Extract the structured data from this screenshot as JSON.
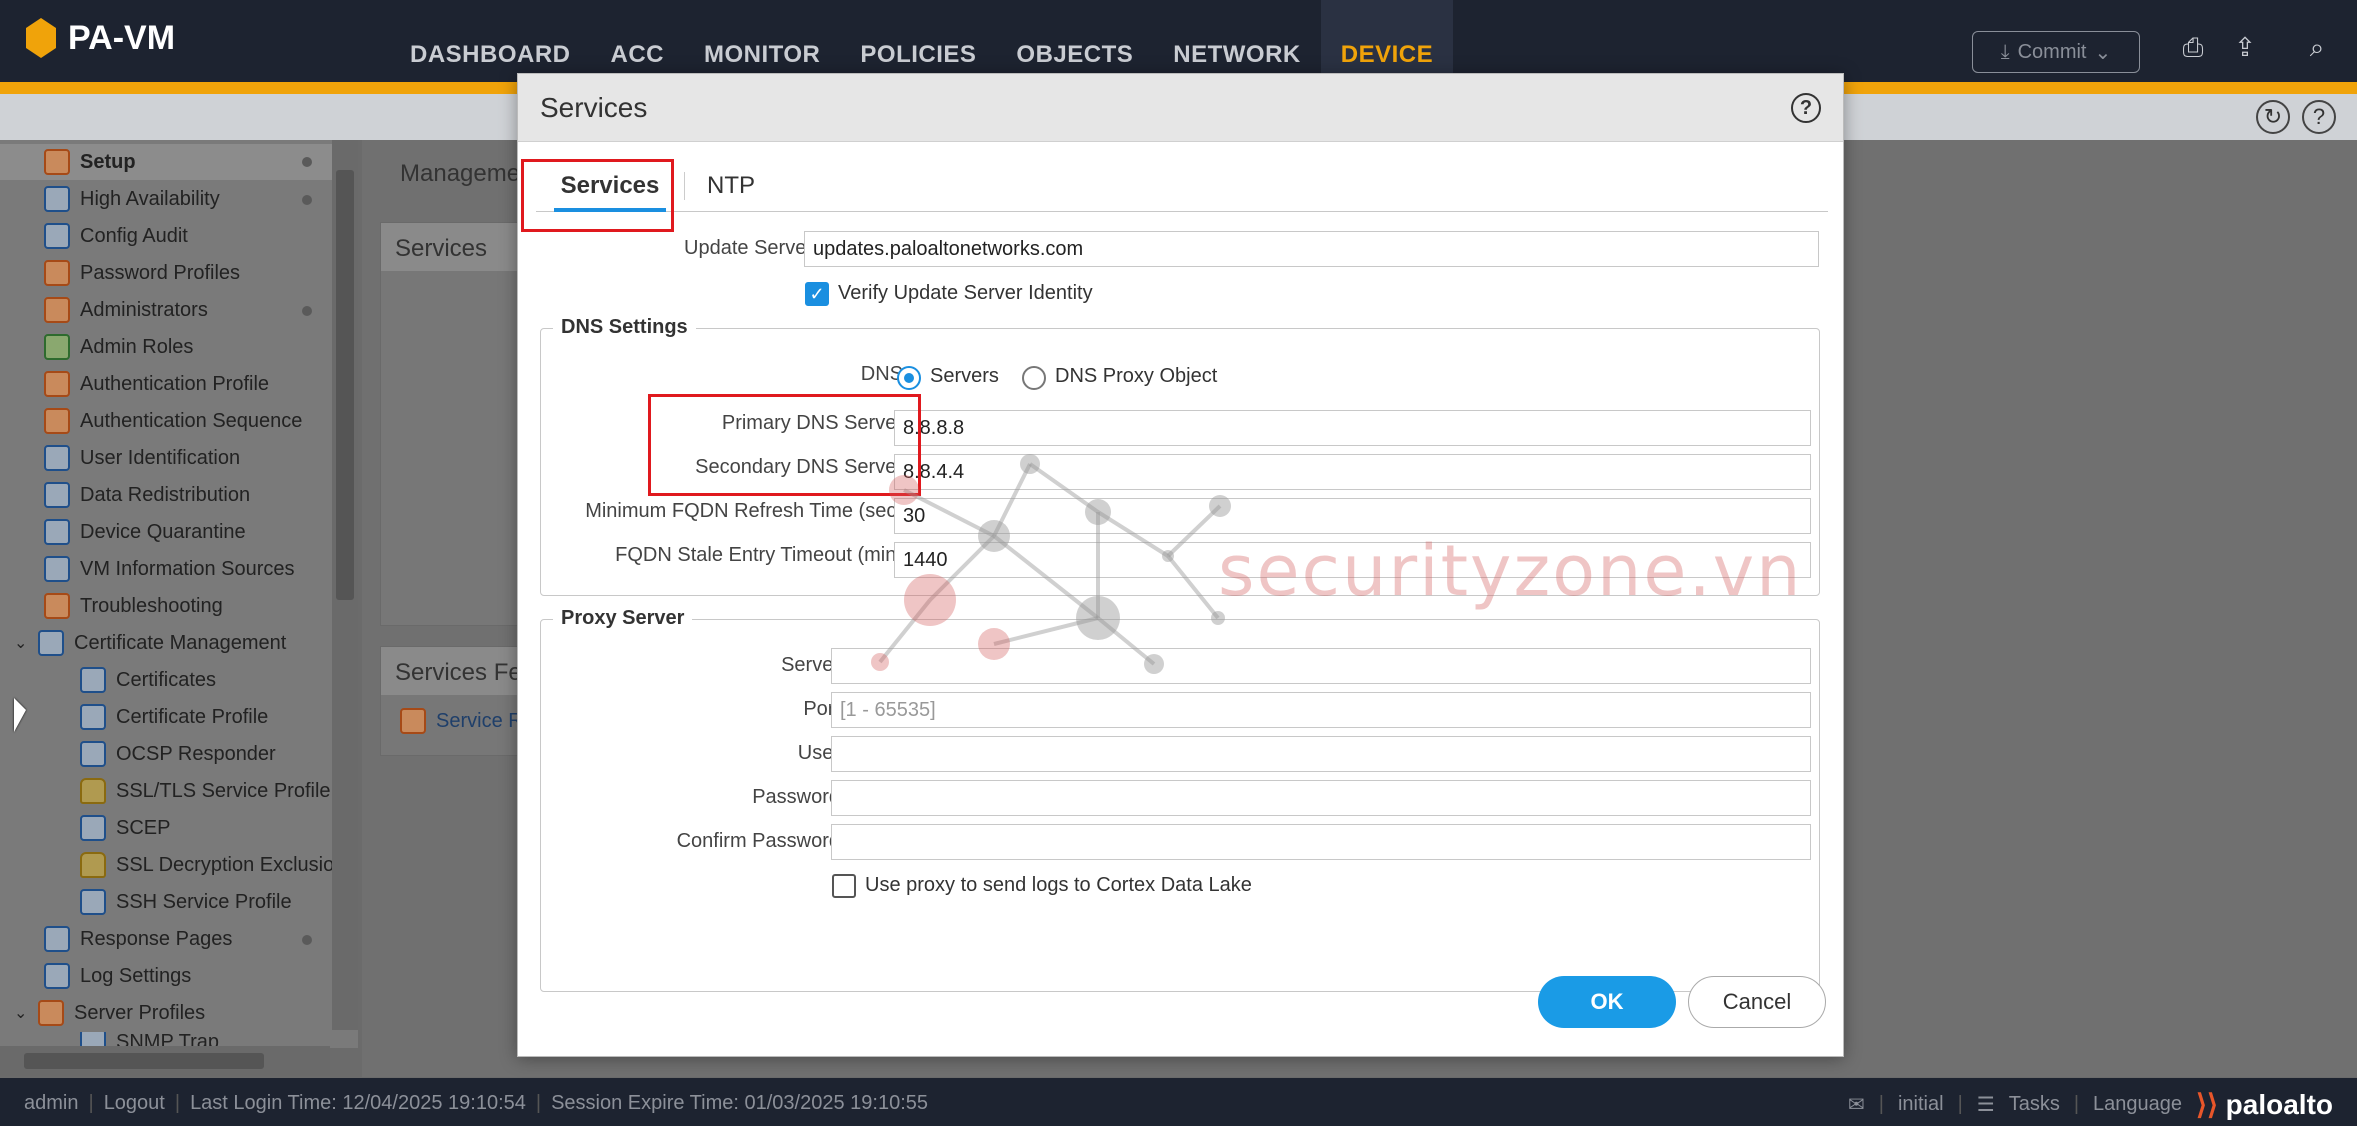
{
  "app": {
    "name": "PA-VM"
  },
  "nav": [
    "DASHBOARD",
    "ACC",
    "MONITOR",
    "POLICIES",
    "OBJECTS",
    "NETWORK",
    "DEVICE"
  ],
  "nav_active": "DEVICE",
  "commit_label": "Commit",
  "sidebar": {
    "items": [
      {
        "label": "Setup"
      },
      {
        "label": "High Availability"
      },
      {
        "label": "Config Audit"
      },
      {
        "label": "Password Profiles"
      },
      {
        "label": "Administrators"
      },
      {
        "label": "Admin Roles"
      },
      {
        "label": "Authentication Profile"
      },
      {
        "label": "Authentication Sequence"
      },
      {
        "label": "User Identification"
      },
      {
        "label": "Data Redistribution"
      },
      {
        "label": "Device Quarantine"
      },
      {
        "label": "VM Information Sources"
      },
      {
        "label": "Troubleshooting"
      },
      {
        "label": "Certificate Management"
      },
      {
        "label": "Certificates"
      },
      {
        "label": "Certificate Profile"
      },
      {
        "label": "OCSP Responder"
      },
      {
        "label": "SSL/TLS Service Profile"
      },
      {
        "label": "SCEP"
      },
      {
        "label": "SSL Decryption Exclusio"
      },
      {
        "label": "SSH Service Profile"
      },
      {
        "label": "Response Pages"
      },
      {
        "label": "Log Settings"
      },
      {
        "label": "Server Profiles"
      },
      {
        "label": "SNMP Trap"
      }
    ]
  },
  "background": {
    "tab": "Manageme",
    "panel1": "Services",
    "panel2": "Services Fea",
    "link": "Service R"
  },
  "modal": {
    "title": "Services",
    "tabs": [
      "Services",
      "NTP"
    ],
    "update_server": {
      "label": "Update Server",
      "value": "updates.paloaltonetworks.com"
    },
    "verify_identity": {
      "label": "Verify Update Server Identity",
      "checked": true
    },
    "dns_settings": {
      "legend": "DNS Settings",
      "dns_label": "DNS",
      "options": [
        "Servers",
        "DNS Proxy Object"
      ],
      "selected": "Servers",
      "primary": {
        "label": "Primary DNS Server",
        "value": "8.8.8.8"
      },
      "secondary": {
        "label": "Secondary DNS Server",
        "value": "8.8.4.4"
      },
      "min_refresh": {
        "label": "Minimum FQDN Refresh Time (sec)",
        "value": "30"
      },
      "stale_timeout": {
        "label": "FQDN Stale Entry Timeout (min)",
        "value": "1440"
      }
    },
    "proxy": {
      "legend": "Proxy Server",
      "server": {
        "label": "Server",
        "value": ""
      },
      "port": {
        "label": "Port",
        "value": "",
        "placeholder": "[1 - 65535]"
      },
      "user": {
        "label": "User",
        "value": ""
      },
      "password": {
        "label": "Password",
        "value": ""
      },
      "confirm_password": {
        "label": "Confirm Password",
        "value": ""
      },
      "use_proxy_cdl": {
        "label": "Use proxy to send logs to Cortex Data Lake",
        "checked": false
      }
    },
    "ok_label": "OK",
    "cancel_label": "Cancel"
  },
  "watermark": "securityzone.vn",
  "status": {
    "user": "admin",
    "logout": "Logout",
    "last_login": "Last Login Time: 12/04/2025 19:10:54",
    "session_expire": "Session Expire Time: 01/03/2025 19:10:55",
    "initial": "initial",
    "tasks": "Tasks",
    "language": "Language",
    "brand": "paloalto"
  },
  "colors": {
    "accent": "#f0a30a",
    "primary_button": "#1a9be6",
    "highlight_box": "#e0191e"
  }
}
